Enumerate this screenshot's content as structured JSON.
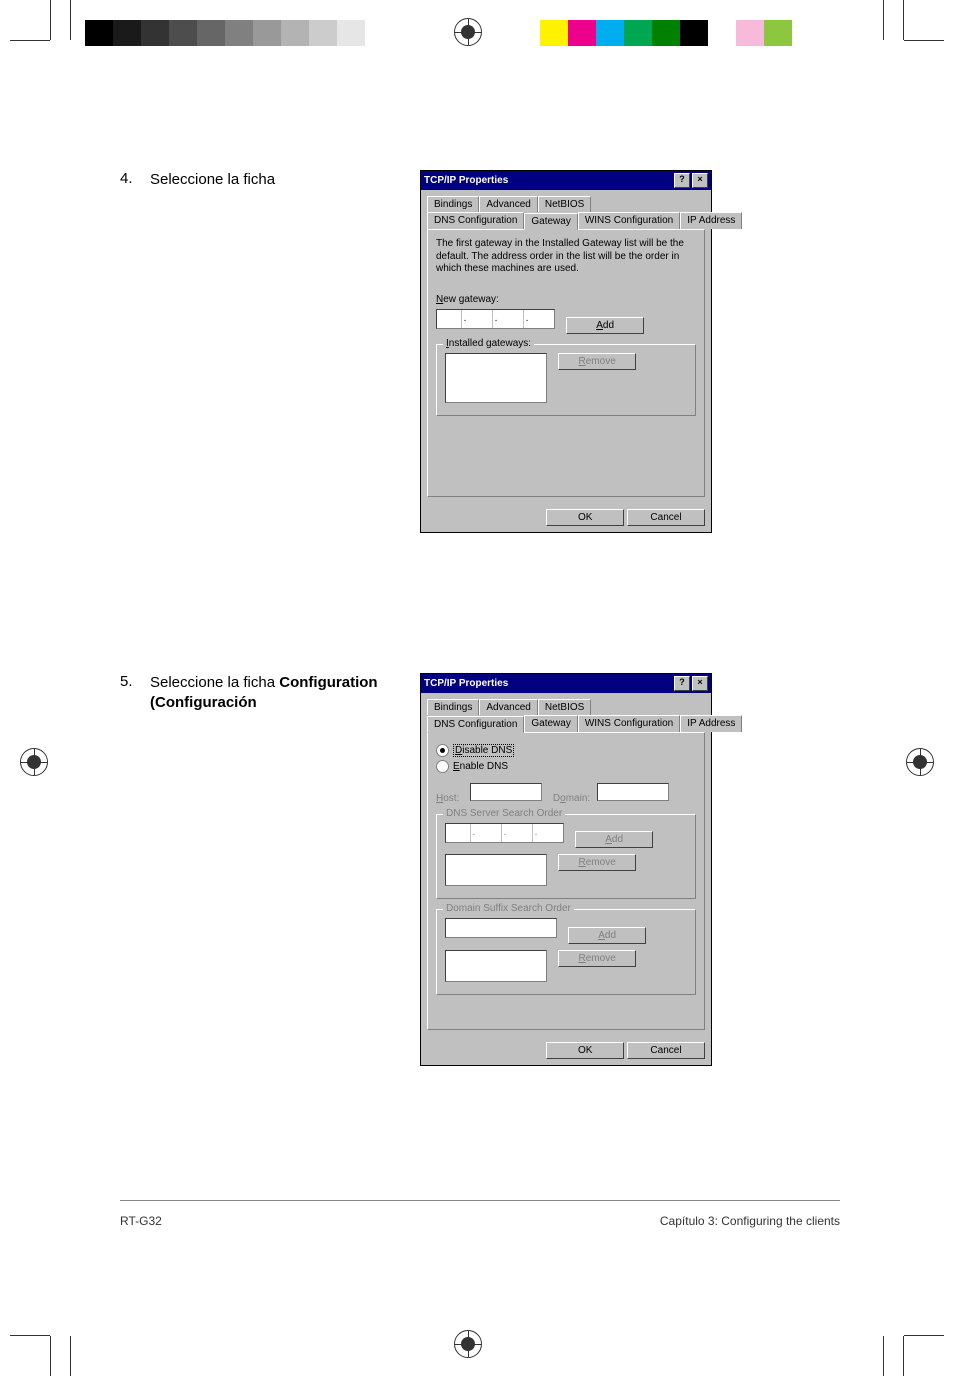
{
  "colors": {
    "swatches_gray": [
      "#000000",
      "#1a1a1a",
      "#333333",
      "#4d4d4d",
      "#666666",
      "#808080",
      "#999999",
      "#b3b3b3",
      "#cccccc",
      "#e6e6e6",
      "#ffffff"
    ],
    "swatches_cmyk": [
      "#00aeef",
      "#ec008c",
      "#fff200",
      "#000000",
      "#ffffff",
      "#00a651",
      "#ed1c24",
      "#2e3192",
      "#f7941d"
    ],
    "swatches_right": [
      "#fff200",
      "#ec008c",
      "#00aeef",
      "#00a651",
      "#008000",
      "#000000",
      "#ffffff",
      "#f7bada",
      "#8dc63f"
    ]
  },
  "page": {
    "step4": {
      "num": "4.",
      "text": "Seleccione la ficha"
    },
    "step5": {
      "num": "5.",
      "text_a": "Seleccione la ficha ",
      "text_b": "Configuration (Configuración"
    },
    "footer_left": "RT-G32",
    "footer_right": "Capítulo 3: Configuring the clients"
  },
  "dlg_common": {
    "title": "TCP/IP Properties",
    "help_btn": "?",
    "close_btn": "×",
    "tabs_row1": [
      "Bindings",
      "Advanced",
      "NetBIOS"
    ],
    "tabs_row2": [
      "DNS Configuration",
      "Gateway",
      "WINS Configuration",
      "IP Address"
    ],
    "ok": "OK",
    "cancel": "Cancel"
  },
  "dlg1": {
    "help": "The first gateway in the Installed Gateway list will be the default. The address order in the list will be the order in which these machines are used.",
    "new_gateway_u": "N",
    "new_gateway_rest": "ew gateway:",
    "add_u": "A",
    "add_rest": "dd",
    "installed_u": "I",
    "installed_rest": "nstalled gateways:",
    "remove_u": "R",
    "remove_rest": "emove"
  },
  "dlg2": {
    "disable_u": "D",
    "disable_rest": "isable DNS",
    "enable_u": "E",
    "enable_rest": "nable DNS",
    "host_u": "H",
    "host_rest": "ost:",
    "domain_u": "o",
    "domain_pre": "D",
    "domain_rest": "main:",
    "dns_order": "DNS Server Search Order",
    "suffix_order": "Domain Suffix Search Order",
    "add_u": "A",
    "add_rest": "dd",
    "remove_u": "R",
    "remove_rest": "emove"
  }
}
